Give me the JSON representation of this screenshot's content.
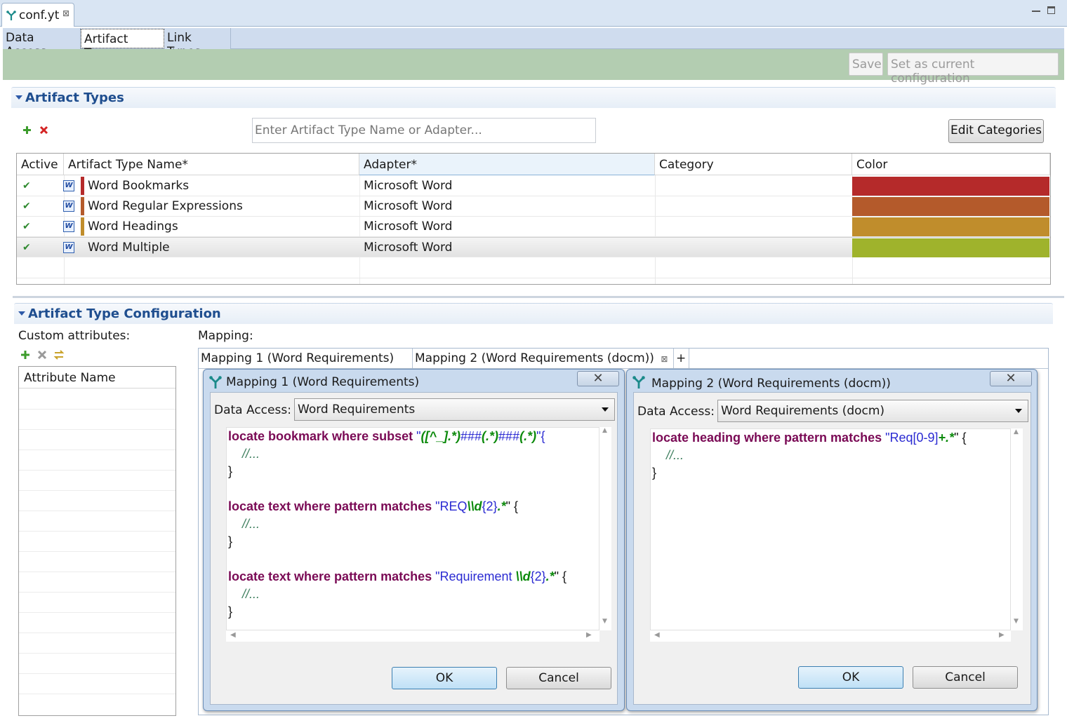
{
  "editor": {
    "tab_title": "conf.yt",
    "tab_close": "⊠"
  },
  "page_tabs": [
    "Data Access",
    "Artifact Types",
    "Link Types"
  ],
  "toolbar": {
    "save_label": "Save",
    "set_config_label": "Set as current configuration"
  },
  "artifact_types": {
    "section_title": "Artifact Types",
    "search_placeholder": "Enter Artifact Type Name or Adapter...",
    "edit_categories_label": "Edit Categories",
    "columns": [
      "Active",
      "Artifact Type Name*",
      "Adapter*",
      "Category",
      "Color"
    ],
    "rows": [
      {
        "name": "Word Bookmarks",
        "adapter": "Microsoft Word",
        "category": "",
        "color": "#b52a2a",
        "marker": "#b52a2a"
      },
      {
        "name": "Word Regular Expressions",
        "adapter": "Microsoft Word",
        "category": "",
        "color": "#b45a2b",
        "marker": "#b45a2b"
      },
      {
        "name": "Word Headings",
        "adapter": "Microsoft Word",
        "category": "",
        "color": "#c08d2c",
        "marker": "#c08d2c"
      },
      {
        "name": "Word Multiple",
        "adapter": "Microsoft Word",
        "category": "",
        "color": "#9fb32c",
        "marker": ""
      }
    ]
  },
  "config": {
    "section_title": "Artifact Type Configuration",
    "custom_attributes_label": "Custom attributes:",
    "attribute_name_header": "Attribute Name",
    "mapping_label": "Mapping:",
    "mapping_tabs": [
      "Mapping 1 (Word Requirements)",
      "Mapping 2 (Word Requirements (docm))"
    ],
    "mapping_tab_close": "⊠",
    "add_tab": "+"
  },
  "dialog1": {
    "title": "Mapping 1 (Word Requirements)",
    "data_access_label": "Data Access:",
    "data_access_value": "Word Requirements",
    "ok": "OK",
    "cancel": "Cancel"
  },
  "dialog2": {
    "title": "Mapping 2 (Word Requirements (docm))",
    "data_access_label": "Data Access:",
    "data_access_value": "Word Requirements (docm)",
    "ok": "OK",
    "cancel": "Cancel"
  },
  "code": {
    "kw_bookmark": "locate bookmark where subset ",
    "kw_text": "locate text where pattern matches ",
    "kw_heading": "locate heading where pattern matches ",
    "comment": "//...",
    "open_brace": "{",
    "close_brace": "}",
    "q": "\"",
    "bm_p1": "([^_].",
    "bm_p2": "*)",
    "bm_p3": "###",
    "bm_p4": "(.*)",
    "bm_p5": "###",
    "bm_p6": "(.*)",
    "bm_p7": "\"{",
    "req_a": "REQ",
    "req_b": "\\\\d",
    "req_c": "{2}",
    "req_d": ".*",
    "req_e": "\" {",
    "rq_a": "Requirement ",
    "rq_b": "\\\\d",
    "rq_c": "{2}",
    "rq_d": ".*",
    "rq_e": "\" {",
    "hd_a": "Req[0-9]",
    "hd_b": "+.*",
    "hd_c": "\" {"
  },
  "colors": {
    "accent": "#1f4e8f",
    "toolbar_bg": "#b3cdb1",
    "keyword": "#7a0a55",
    "string": "#2a2ad2",
    "regex": "#0c8a0c"
  }
}
